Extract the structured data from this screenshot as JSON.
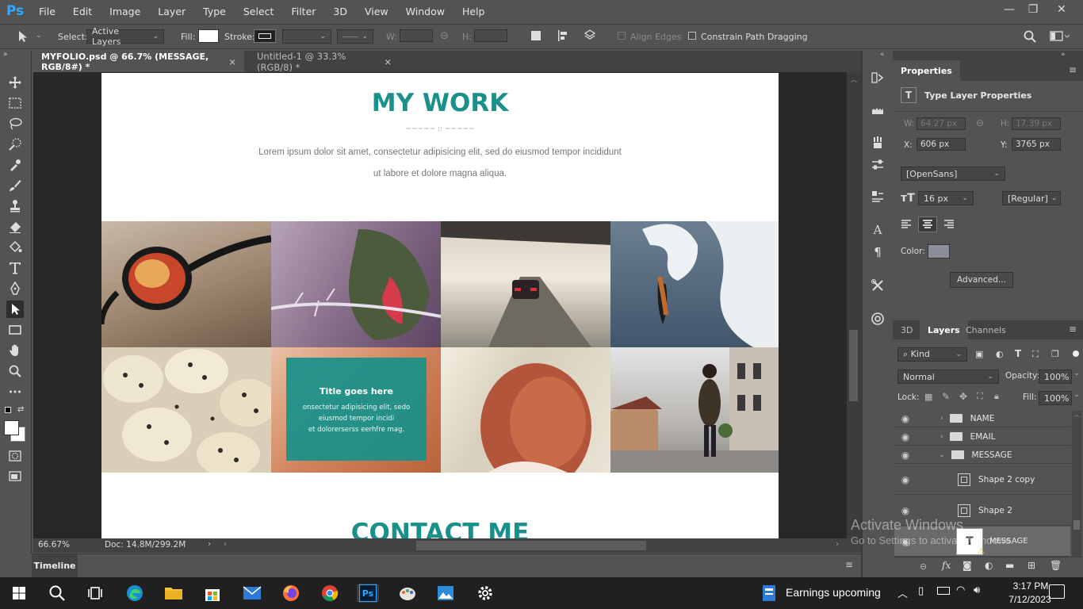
{
  "app": {
    "logo": "Ps"
  },
  "menu": [
    "File",
    "Edit",
    "Image",
    "Layer",
    "Type",
    "Select",
    "Filter",
    "3D",
    "View",
    "Window",
    "Help"
  ],
  "options": {
    "select_label": "Select:",
    "select_value": "Active Layers",
    "fill_label": "Fill:",
    "stroke_label": "Stroke:",
    "w_label": "W:",
    "h_label": "H:",
    "align_edges": "Align Edges",
    "constrain": "Constrain Path Dragging"
  },
  "tabs": [
    {
      "label": "MYFOLIO.psd @ 66.7% (MESSAGE, RGB/8#) *",
      "close": "×"
    },
    {
      "label": "Untitled-1 @ 33.3% (RGB/8) *",
      "close": "×"
    }
  ],
  "document": {
    "heading": "MY WORK",
    "divider": "~~~~~ :: ~~~~~",
    "para1": "Lorem ipsum dolor sit amet, consectetur adipisicing elit, sed do eiusmod tempor incididunt",
    "para2": "ut labore et dolore magna aliqua.",
    "overlay_title": "Title goes here",
    "overlay_line1": "onsectetur adipisicing elit, sedo",
    "overlay_line2": "eiusmod tempor incidi",
    "overlay_line3": "et dolorerserss eerhfre mag.",
    "contact": "CONTACT ME"
  },
  "status": {
    "zoom": "66.67%",
    "doc": "Doc: 14.8M/299.2M"
  },
  "timeline": {
    "label": "Timeline"
  },
  "properties": {
    "tab": "Properties",
    "title": "Type Layer Properties",
    "w_label": "W:",
    "w_value": "64.27 px",
    "h_label": "H:",
    "h_value": "17.39 px",
    "x_label": "X:",
    "x_value": "606 px",
    "y_label": "Y:",
    "y_value": "3765 px",
    "font": "[OpenSans]",
    "size": "16 px",
    "style": "[Regular]",
    "color_label": "Color:",
    "advanced": "Advanced..."
  },
  "layers_panel": {
    "tabs": [
      "3D",
      "Layers",
      "Channels"
    ],
    "kind": "Kind",
    "blend": "Normal",
    "opacity_label": "Opacity:",
    "opacity": "100%",
    "lock_label": "Lock:",
    "fill_label": "Fill:",
    "fill": "100%",
    "layers": [
      {
        "name": "NAME",
        "type": "group"
      },
      {
        "name": "EMAIL",
        "type": "group"
      },
      {
        "name": "MESSAGE",
        "type": "group-open"
      },
      {
        "name": "Shape 2 copy",
        "type": "shape"
      },
      {
        "name": "Shape 2",
        "type": "shape"
      },
      {
        "name": "MESSAGE",
        "type": "text"
      }
    ]
  },
  "watermark": {
    "line1": "Activate Windows",
    "line2": "Go to Settings to activate Windows."
  },
  "taskbar": {
    "notification": "Earnings upcoming",
    "time": "3:17 PM",
    "date": "7/12/2023"
  },
  "colors": {
    "teal": "#19918a",
    "ps_blue": "#31a8ff"
  }
}
